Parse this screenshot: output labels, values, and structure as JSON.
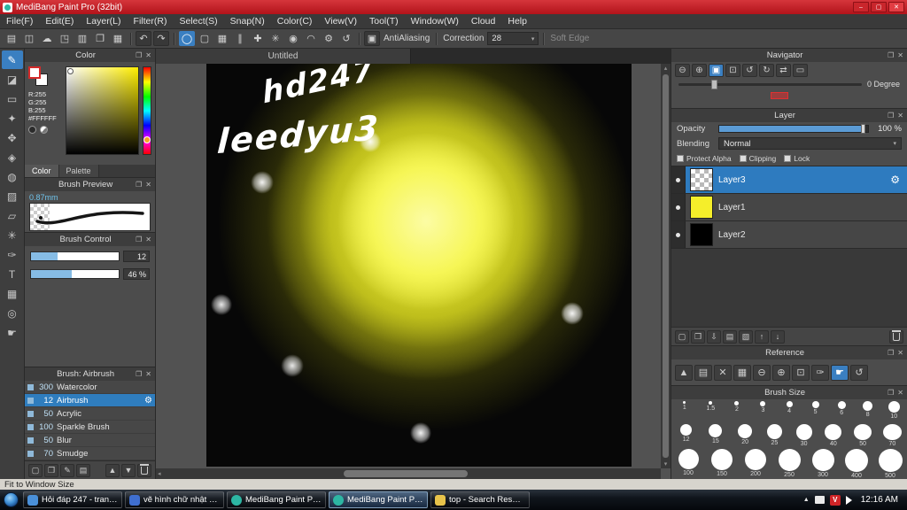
{
  "window": {
    "title": "MediBang Paint Pro (32bit)",
    "controls": {
      "minimize": "–",
      "maximize": "▢",
      "close": "✕"
    }
  },
  "icons": {
    "popout": "❐",
    "close": "✕",
    "gear": "⚙",
    "tri_down": "▾",
    "tri_up": "▴",
    "tri_left": "◂",
    "tri_right": "▸",
    "undo": "↶",
    "redo": "↷",
    "hidden_tray": "▲"
  },
  "menu": {
    "items": [
      "File(F)",
      "Edit(E)",
      "Layer(L)",
      "Filter(R)",
      "Select(S)",
      "Snap(N)",
      "Color(C)",
      "View(V)",
      "Tool(T)",
      "Window(W)",
      "Cloud",
      "Help"
    ]
  },
  "toolbar": {
    "file_icons": [
      "▤",
      "◫",
      "☁",
      "◳",
      "▥",
      "❐",
      "▦"
    ],
    "option_icons": [
      "◯",
      "▢",
      "▦",
      "∥",
      "✚",
      "✳",
      "◉",
      "◠",
      "⚙",
      "↺"
    ],
    "antialiasing_icon": "▣",
    "antialiasing": "AntiAliasing",
    "correction_label": "Correction",
    "correction_value": "28",
    "soft_edge": "Soft Edge"
  },
  "tools": {
    "glyphs": [
      "✎",
      "◪",
      "▭",
      "✦",
      "✥",
      "◈",
      "◍",
      "▨",
      "▱",
      "✳",
      "✑",
      "T",
      "▦",
      "◎",
      "☛"
    ]
  },
  "panels": {
    "color": {
      "title": "Color",
      "r": "R:255",
      "g": "G:255",
      "b": "B:255",
      "hex": "#FFFFFF",
      "tab_color": "Color",
      "tab_palette": "Palette"
    },
    "brush_preview": {
      "title": "Brush Preview",
      "size": "0.87mm"
    },
    "brush_control": {
      "title": "Brush Control",
      "value1": "12",
      "value2": "46 %"
    },
    "brush_list": {
      "title": "Brush: Airbrush",
      "items": [
        {
          "size": "300",
          "name": "Watercolor"
        },
        {
          "size": "12",
          "name": "Airbrush"
        },
        {
          "size": "50",
          "name": "Acrylic"
        },
        {
          "size": "100",
          "name": "Sparkle Brush"
        },
        {
          "size": "50",
          "name": "Blur"
        },
        {
          "size": "70",
          "name": "Smudge"
        }
      ],
      "tool_icons": [
        "▢",
        "❐",
        "✎",
        "▤",
        "▲",
        "▼"
      ]
    },
    "navigator": {
      "title": "Navigator",
      "icons": [
        "⊖",
        "⊕",
        "▣",
        "⊡",
        "↺",
        "↻",
        "⇄",
        "▭"
      ],
      "degree": "0 Degree"
    },
    "layer": {
      "title": "Layer",
      "opacity_label": "Opacity",
      "opacity_value": "100 %",
      "blending_label": "Blending",
      "blending_value": "Normal",
      "protect_alpha": "Protect Alpha",
      "clipping": "Clipping",
      "lock": "Lock",
      "layers": [
        {
          "name": "Layer3"
        },
        {
          "name": "Layer1"
        },
        {
          "name": "Layer2"
        }
      ],
      "tool_icons": [
        "▢",
        "❐",
        "⇩",
        "▤",
        "▧",
        "↑",
        "↓"
      ]
    },
    "reference": {
      "title": "Reference",
      "icons": [
        "▲",
        "▤",
        "✕",
        "▦",
        "⊖",
        "⊕",
        "⊡",
        "✑",
        "☛",
        "↺"
      ]
    },
    "brush_size": {
      "title": "Brush Size",
      "row1": [
        "1",
        "1.5",
        "2",
        "3",
        "4",
        "5",
        "6",
        "8",
        "10"
      ],
      "row2": [
        "12",
        "15",
        "20",
        "25",
        "30",
        "40",
        "50",
        "70"
      ],
      "row3": [
        "100",
        "150",
        "200",
        "250",
        "300",
        "400",
        "500"
      ]
    }
  },
  "canvas": {
    "tab": "Untitled",
    "text1": "hd247",
    "text2": "leedyu3"
  },
  "status": {
    "text": "Fit to Window Size"
  },
  "taskbar": {
    "items": [
      {
        "label": "Hỏi đáp 247 - trang t..."
      },
      {
        "label": "vẽ hình chữ nhật có ..."
      },
      {
        "label": "MediBang Paint Pro ..."
      },
      {
        "label": "MediBang Paint Pro ..."
      },
      {
        "label": "top - Search Results i..."
      }
    ],
    "tray": {
      "unikey": "V",
      "clock": "12:16 AM"
    }
  },
  "colors": {
    "titlebar_red": "#c11a20",
    "accent_blue": "#2f7dbe",
    "selection_blue": "#3a7fc1",
    "glow_yellow": "#f2f240",
    "layer1_thumb": "#f5ee2a",
    "layer2_thumb": "#000000"
  }
}
